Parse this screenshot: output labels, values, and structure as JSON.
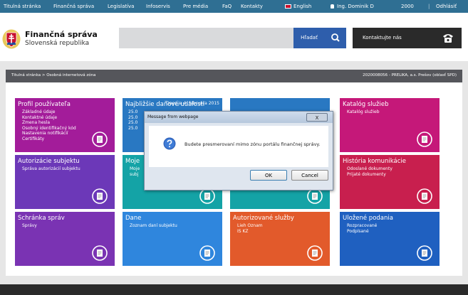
{
  "topnav": {
    "items": [
      "Titulná stránka",
      "Finančná správa",
      "Legislatíva",
      "Infoservis",
      "Pre média",
      "FaQ",
      "Kontakty"
    ],
    "language": "English",
    "user": "Ing. Dominik D",
    "code": "2000",
    "logout": "Odhlásiť"
  },
  "header": {
    "org_name": "Finančná správa",
    "org_sub": "Slovenská republika",
    "search_button": "Hľadať",
    "contact_button": "Kontaktujte nás"
  },
  "breadcrumb": {
    "path": "Titulná stránka > Osobná internetová zóna",
    "user_info": "2020008056 - PRELIKA, a.s. Prešov (oblasť SPD)"
  },
  "tiles": [
    {
      "title": "Profil používateľa",
      "color": "#a31c9a",
      "items": [
        "Základné údaje",
        "Kontaktné údaje",
        "Zmena hesla",
        "Osobný identifikačný kód",
        "Nastavenia notifikácií",
        "Certifikáty"
      ]
    },
    {
      "title": "Najbližšie daňové udalosti",
      "color": "#2978c2",
      "date": "Dnes je 4. februára 2015",
      "items": [
        "25.0",
        "25.0",
        "25.0",
        "25.0"
      ]
    },
    {
      "title": "Katalóg služieb",
      "color": "#c51879",
      "items": [
        "Katalóg služieb"
      ]
    },
    {
      "title": "Autorizácie subjektu",
      "color": "#6c38b8",
      "items": [
        "Správa autorizácií subjektu"
      ]
    },
    {
      "title": "Moje",
      "color": "#14a3a6",
      "items": [
        "Moje",
        "subj"
      ]
    },
    {
      "title": "",
      "color": "#14a3a6",
      "items": []
    },
    {
      "title": "História komunikácie",
      "color": "#c81f4e",
      "items": [
        "Odoslané dokumenty",
        "Prijaté dokumenty"
      ]
    },
    {
      "title": "Schránka správ",
      "color": "#7a33b3",
      "items": [
        "Správy"
      ]
    },
    {
      "title": "Dane",
      "color": "#2f86dd",
      "items": [
        "Zoznam daní subjektu"
      ]
    },
    {
      "title": "Autorizované služby",
      "color": "#e25a2b",
      "items": [
        "Lieh Oznam",
        "IS KZ"
      ]
    },
    {
      "title": "Uložené podania",
      "color": "#1f60c0",
      "items": [
        "Rozpracované",
        "Podpísané"
      ]
    }
  ],
  "dialog": {
    "title": "Message from webpage",
    "message": "Budete presmerovaní mimo zónu portálu finančnej správy.",
    "ok": "OK",
    "cancel": "Cancel",
    "close": "X"
  }
}
